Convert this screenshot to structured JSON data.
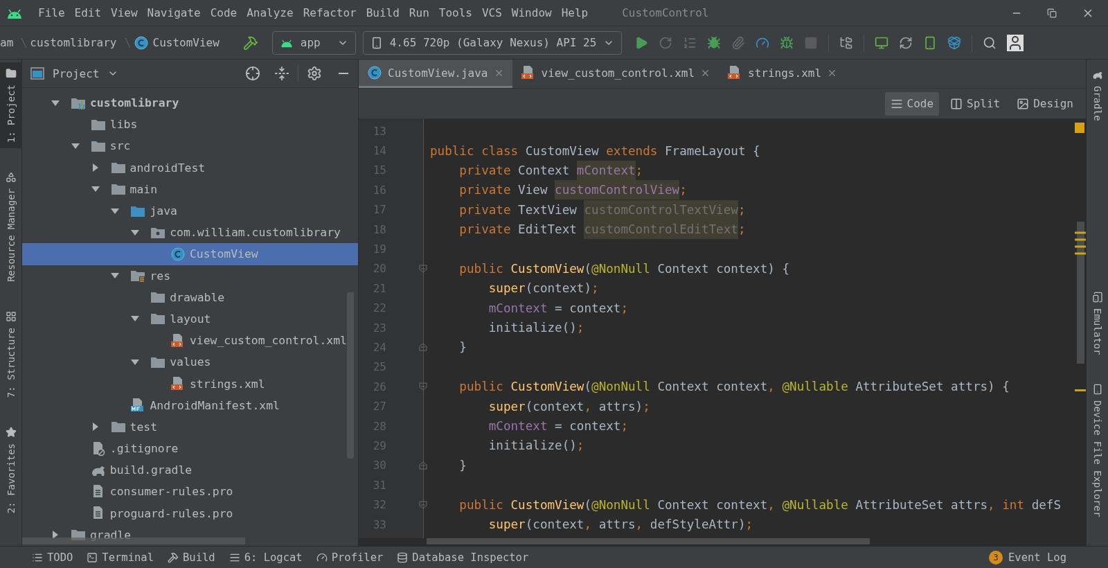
{
  "title_bar": {
    "menus": [
      "File",
      "Edit",
      "View",
      "Navigate",
      "Code",
      "Analyze",
      "Refactor",
      "Build",
      "Run",
      "Tools",
      "VCS",
      "Window",
      "Help"
    ],
    "project_title": "CustomControl"
  },
  "nav_bar": {
    "breadcrumbs": [
      "am",
      "customlibrary",
      "CustomView"
    ],
    "run_config": "app",
    "device": "4.65 720p (Galaxy Nexus) API 25"
  },
  "left_tool_windows": [
    {
      "label": "1: Project",
      "kind": "folder",
      "selected": true
    },
    {
      "label": "Resource Manager",
      "kind": "shapes",
      "selected": false
    },
    {
      "label": "7: Structure",
      "kind": "structure",
      "selected": false
    },
    {
      "label": "2: Favorites",
      "kind": "star",
      "selected": false
    }
  ],
  "project_panel": {
    "title": "Project",
    "tree": [
      {
        "label": "customlibrary",
        "kind": "module",
        "expanded": true,
        "selected": false,
        "children": [
          {
            "label": "libs",
            "kind": "folder",
            "selected": false
          },
          {
            "label": "src",
            "kind": "folder",
            "expanded": true,
            "selected": false,
            "children": [
              {
                "label": "androidTest",
                "kind": "folder",
                "expanded": false,
                "selected": false
              },
              {
                "label": "main",
                "kind": "folder",
                "expanded": true,
                "selected": false,
                "children": [
                  {
                    "label": "java",
                    "kind": "source_folder",
                    "expanded": true,
                    "selected": false,
                    "children": [
                      {
                        "label": "com.william.customlibrary",
                        "kind": "package",
                        "expanded": true,
                        "selected": false,
                        "children": [
                          {
                            "label": "CustomView",
                            "kind": "class",
                            "selected": true
                          }
                        ]
                      }
                    ]
                  },
                  {
                    "label": "res",
                    "kind": "resources",
                    "expanded": true,
                    "selected": false,
                    "children": [
                      {
                        "label": "drawable",
                        "kind": "folder",
                        "selected": false
                      },
                      {
                        "label": "layout",
                        "kind": "folder",
                        "expanded": true,
                        "selected": false,
                        "children": [
                          {
                            "label": "view_custom_control.xml",
                            "kind": "xml",
                            "selected": false
                          }
                        ]
                      },
                      {
                        "label": "values",
                        "kind": "folder",
                        "expanded": true,
                        "selected": false,
                        "children": [
                          {
                            "label": "strings.xml",
                            "kind": "xml",
                            "selected": false
                          }
                        ]
                      }
                    ]
                  },
                  {
                    "label": "AndroidManifest.xml",
                    "kind": "manifest",
                    "selected": false
                  }
                ]
              },
              {
                "label": "test",
                "kind": "folder",
                "expanded": false,
                "selected": false
              }
            ]
          },
          {
            "label": ".gitignore",
            "kind": "gitignore",
            "selected": false
          },
          {
            "label": "build.gradle",
            "kind": "gradle",
            "selected": false
          },
          {
            "label": "consumer-rules.pro",
            "kind": "file",
            "selected": false
          },
          {
            "label": "proguard-rules.pro",
            "kind": "file",
            "selected": false
          }
        ]
      },
      {
        "label": "gradle",
        "kind": "folder",
        "expanded": false,
        "selected": false
      }
    ]
  },
  "editor": {
    "tabs": [
      {
        "label": "CustomView.java",
        "kind": "class",
        "selected": true
      },
      {
        "label": "view_custom_control.xml",
        "kind": "xml",
        "selected": false
      },
      {
        "label": "strings.xml",
        "kind": "xml",
        "selected": false
      }
    ],
    "view_modes": [
      {
        "label": "Code",
        "kind": "lines",
        "selected": true
      },
      {
        "label": "Split",
        "kind": "split",
        "selected": false
      },
      {
        "label": "Design",
        "kind": "image",
        "selected": false
      }
    ],
    "lines": [
      {
        "number": "13",
        "kind": "code"
      },
      {
        "number": "14",
        "kind": "code",
        "tokens": [
          {
            "kind": "keyword",
            "text": "public class "
          },
          {
            "kind": "plain",
            "text": "CustomView "
          },
          {
            "kind": "keyword",
            "text": "extends "
          },
          {
            "kind": "plain",
            "text": "FrameLayout {"
          }
        ]
      },
      {
        "number": "15",
        "kind": "code",
        "tokens": [
          {
            "kind": "keyword",
            "text": "    private "
          },
          {
            "kind": "plain",
            "text": "Context "
          },
          {
            "kind": "field_usage",
            "text": "mContext"
          },
          {
            "kind": "punct",
            "text": ";"
          }
        ]
      },
      {
        "number": "16",
        "kind": "code",
        "tokens": [
          {
            "kind": "keyword",
            "text": "    private "
          },
          {
            "kind": "plain",
            "text": "View "
          },
          {
            "kind": "field_usage",
            "text": "customControlView"
          },
          {
            "kind": "punct",
            "text": ";"
          }
        ]
      },
      {
        "number": "17",
        "kind": "code",
        "tokens": [
          {
            "kind": "keyword",
            "text": "    private "
          },
          {
            "kind": "plain",
            "text": "TextView "
          },
          {
            "kind": "unused_usage",
            "text": "customControlTextView"
          },
          {
            "kind": "punct",
            "text": ";"
          }
        ]
      },
      {
        "number": "18",
        "kind": "code",
        "tokens": [
          {
            "kind": "keyword",
            "text": "    private "
          },
          {
            "kind": "plain",
            "text": "EditText "
          },
          {
            "kind": "unused_usage",
            "text": "customControlEditText"
          },
          {
            "kind": "punct",
            "text": ";"
          }
        ]
      },
      {
        "number": "19",
        "kind": "code"
      },
      {
        "number": "20",
        "kind": "fold_start",
        "tokens": [
          {
            "kind": "keyword",
            "text": "    public "
          },
          {
            "kind": "method",
            "text": "CustomView"
          },
          {
            "kind": "plain",
            "text": "("
          },
          {
            "kind": "annotation",
            "text": "@NonNull"
          },
          {
            "kind": "plain",
            "text": " Context context) {"
          }
        ]
      },
      {
        "number": "21",
        "kind": "code",
        "tokens": [
          {
            "kind": "method",
            "text": "        super"
          },
          {
            "kind": "plain",
            "text": "(context)"
          },
          {
            "kind": "punct",
            "text": ";"
          }
        ]
      },
      {
        "number": "22",
        "kind": "code",
        "tokens": [
          {
            "kind": "field",
            "text": "        mContext"
          },
          {
            "kind": "plain",
            "text": " = context"
          },
          {
            "kind": "punct",
            "text": ";"
          }
        ]
      },
      {
        "number": "23",
        "kind": "code",
        "tokens": [
          {
            "kind": "plain",
            "text": "        initialize()"
          },
          {
            "kind": "punct",
            "text": ";"
          }
        ]
      },
      {
        "number": "24",
        "kind": "fold_end",
        "tokens": [
          {
            "kind": "plain",
            "text": "    }"
          }
        ]
      },
      {
        "number": "25",
        "kind": "code"
      },
      {
        "number": "26",
        "kind": "fold_start",
        "tokens": [
          {
            "kind": "keyword",
            "text": "    public "
          },
          {
            "kind": "method",
            "text": "CustomView"
          },
          {
            "kind": "plain",
            "text": "("
          },
          {
            "kind": "annotation",
            "text": "@NonNull"
          },
          {
            "kind": "plain",
            "text": " Context context"
          },
          {
            "kind": "punct",
            "text": ", "
          },
          {
            "kind": "annotation",
            "text": "@Nullable"
          },
          {
            "kind": "plain",
            "text": " AttributeSet attrs) {"
          }
        ]
      },
      {
        "number": "27",
        "kind": "code",
        "tokens": [
          {
            "kind": "method",
            "text": "        super"
          },
          {
            "kind": "plain",
            "text": "(context"
          },
          {
            "kind": "punct",
            "text": ", "
          },
          {
            "kind": "plain",
            "text": "attrs)"
          },
          {
            "kind": "punct",
            "text": ";"
          }
        ]
      },
      {
        "number": "28",
        "kind": "code",
        "tokens": [
          {
            "kind": "field",
            "text": "        mContext"
          },
          {
            "kind": "plain",
            "text": " = context"
          },
          {
            "kind": "punct",
            "text": ";"
          }
        ]
      },
      {
        "number": "29",
        "kind": "code",
        "tokens": [
          {
            "kind": "plain",
            "text": "        initialize()"
          },
          {
            "kind": "punct",
            "text": ";"
          }
        ]
      },
      {
        "number": "30",
        "kind": "fold_end",
        "tokens": [
          {
            "kind": "plain",
            "text": "    }"
          }
        ]
      },
      {
        "number": "31",
        "kind": "code"
      },
      {
        "number": "32",
        "kind": "fold_start",
        "tokens": [
          {
            "kind": "keyword",
            "text": "    public "
          },
          {
            "kind": "method",
            "text": "CustomView"
          },
          {
            "kind": "plain",
            "text": "("
          },
          {
            "kind": "annotation",
            "text": "@NonNull"
          },
          {
            "kind": "plain",
            "text": " Context context"
          },
          {
            "kind": "punct",
            "text": ", "
          },
          {
            "kind": "annotation",
            "text": "@Nullable"
          },
          {
            "kind": "plain",
            "text": " AttributeSet attrs"
          },
          {
            "kind": "punct",
            "text": ", "
          },
          {
            "kind": "keyword",
            "text": "int "
          },
          {
            "kind": "plain",
            "text": "defS"
          }
        ]
      },
      {
        "number": "33",
        "kind": "code",
        "tokens": [
          {
            "kind": "method",
            "text": "        super"
          },
          {
            "kind": "plain",
            "text": "(context"
          },
          {
            "kind": "punct",
            "text": ", "
          },
          {
            "kind": "plain",
            "text": "attrs"
          },
          {
            "kind": "punct",
            "text": ", "
          },
          {
            "kind": "plain",
            "text": "defStyleAttr)"
          },
          {
            "kind": "punct",
            "text": ";"
          }
        ]
      }
    ]
  },
  "right_tool_windows": [
    {
      "label": "Gradle",
      "kind": "elephant"
    },
    {
      "label": "Emulator",
      "kind": "device"
    },
    {
      "label": "Device File Explorer",
      "kind": "phone"
    }
  ],
  "bottom_bar": {
    "tools": [
      {
        "label": "TODO",
        "kind": "list"
      },
      {
        "label": "Terminal",
        "kind": "terminal"
      },
      {
        "label": "Build",
        "kind": "hammer"
      },
      {
        "label": "6: Logcat",
        "kind": "lines"
      },
      {
        "label": "Profiler",
        "kind": "gauge"
      },
      {
        "label": "Database Inspector",
        "kind": "database"
      }
    ],
    "event_log": {
      "count": "3",
      "label": "Event Log"
    }
  }
}
